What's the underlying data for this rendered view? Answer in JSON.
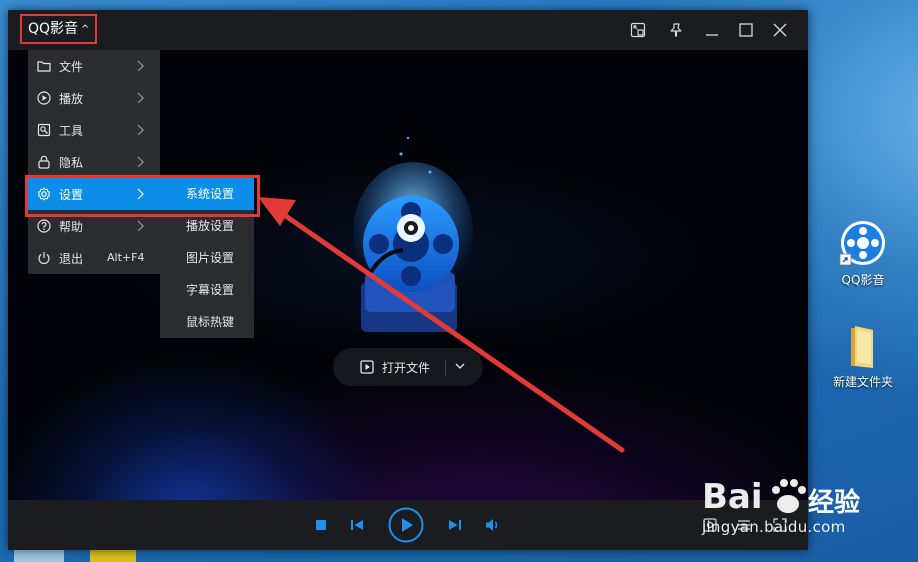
{
  "app": {
    "title": "QQ影音"
  },
  "desktop": {
    "icons": [
      {
        "label": "QQ影音",
        "icon": "qq-player-shortcut-icon"
      },
      {
        "label": "新建文件夹",
        "icon": "folder-icon"
      }
    ]
  },
  "window_controls": [
    {
      "name": "mini-mode",
      "icon": "mini-mode-icon"
    },
    {
      "name": "pin-on-top",
      "icon": "pin-icon"
    },
    {
      "name": "minimize",
      "icon": "minimize-icon"
    },
    {
      "name": "maximize",
      "icon": "maximize-icon"
    },
    {
      "name": "close",
      "icon": "close-icon"
    }
  ],
  "main_menu": {
    "items": [
      {
        "label": "文件",
        "icon": "folder-icon",
        "has_submenu": true
      },
      {
        "label": "播放",
        "icon": "play-circle-icon",
        "has_submenu": true
      },
      {
        "label": "工具",
        "icon": "tools-icon",
        "has_submenu": true
      },
      {
        "label": "隐私",
        "icon": "lock-icon",
        "has_submenu": true
      },
      {
        "label": "设置",
        "icon": "gear-icon",
        "has_submenu": true,
        "active": true
      },
      {
        "label": "帮助",
        "icon": "help-icon",
        "has_submenu": true
      },
      {
        "label": "退出",
        "icon": "power-icon",
        "shortcut": "Alt+F4"
      }
    ]
  },
  "settings_submenu": {
    "items": [
      {
        "label": "系统设置",
        "active": true
      },
      {
        "label": "播放设置"
      },
      {
        "label": "图片设置"
      },
      {
        "label": "字幕设置"
      },
      {
        "label": "鼠标热键"
      }
    ]
  },
  "center": {
    "open_file_label": "打开文件"
  },
  "controls": [
    {
      "name": "stop",
      "icon": "stop-icon"
    },
    {
      "name": "previous",
      "icon": "previous-icon"
    },
    {
      "name": "play",
      "icon": "play-icon"
    },
    {
      "name": "next",
      "icon": "next-icon"
    },
    {
      "name": "volume",
      "icon": "volume-icon"
    }
  ],
  "watermark": {
    "brand": "Bai 经验",
    "url": "jingyan.baidu.com"
  },
  "colors": {
    "accent": "#0c8ee8",
    "annotation_red": "#e23a36",
    "menu_bg": "#2b2c30",
    "titlebar_bg": "#1b1c1f"
  }
}
